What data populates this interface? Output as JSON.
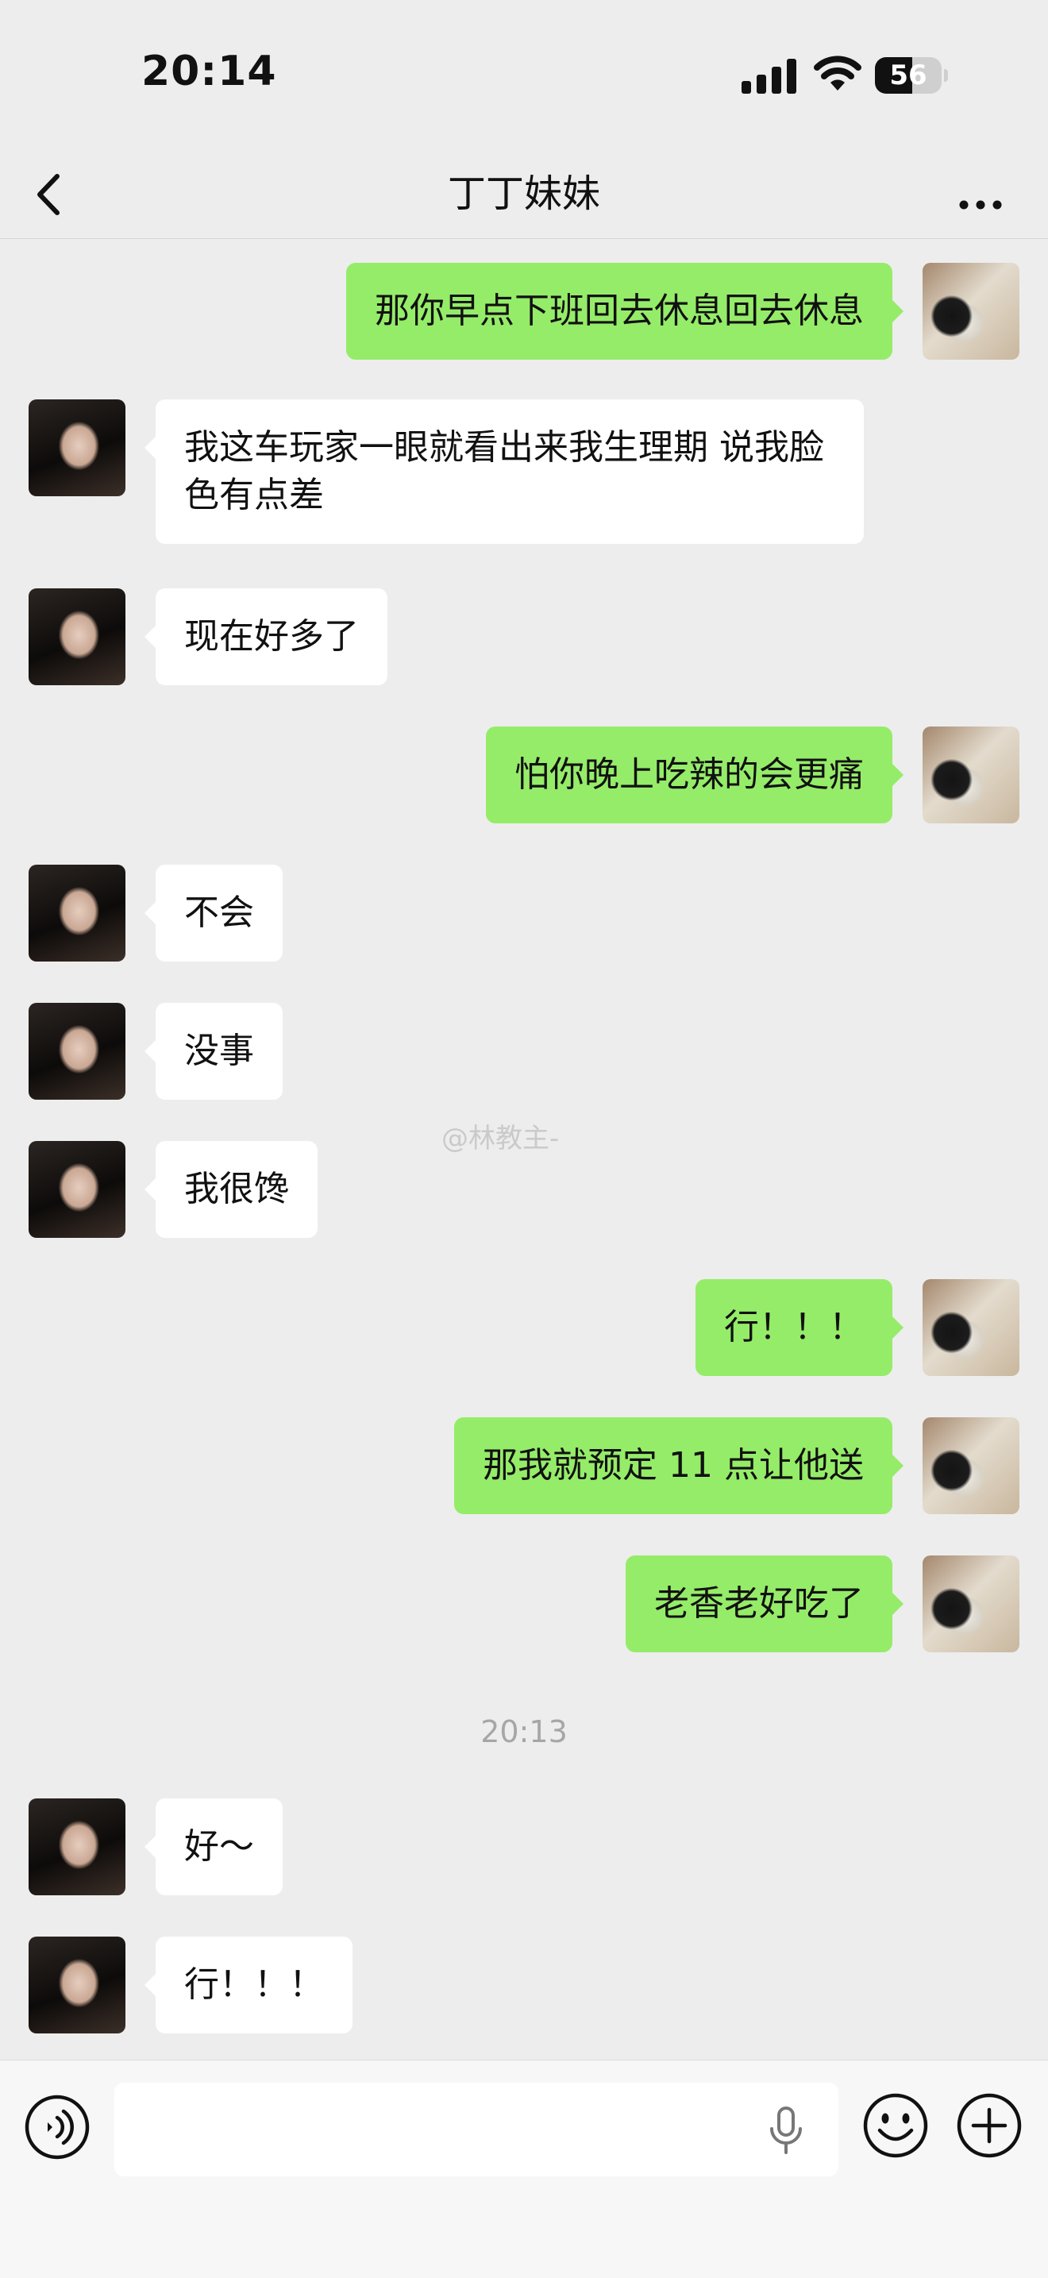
{
  "status_bar": {
    "time": "20:14",
    "battery_level": "56",
    "battery_fraction": 0.56
  },
  "header": {
    "title": "丁丁妹妹",
    "back_icon": "chevron-left-icon",
    "more_icon": "ellipsis-icon"
  },
  "messages": [
    {
      "direction": "out",
      "text": "那你早点下班回去休息回去休息"
    },
    {
      "direction": "in",
      "text": "我这车玩家一眼就看出来我生理期 说我脸色有点差"
    },
    {
      "direction": "in",
      "text": "现在好多了"
    },
    {
      "direction": "out",
      "text": "怕你晚上吃辣的会更痛"
    },
    {
      "direction": "in",
      "text": "不会"
    },
    {
      "direction": "in",
      "text": "没事"
    },
    {
      "direction": "in",
      "text": "我很馋"
    },
    {
      "direction": "out",
      "text": "行！！！"
    },
    {
      "direction": "out",
      "text": "那我就预定 11 点让他送"
    },
    {
      "direction": "out",
      "text": "老香老好吃了"
    },
    {
      "direction": "in",
      "text": "好～"
    },
    {
      "direction": "in",
      "text": "行！！！"
    }
  ],
  "timestamp": "20:13",
  "watermark": "@林教主-",
  "input_bar": {
    "placeholder": "",
    "voice_icon": "voice-wave-icon",
    "mic_icon": "microphone-icon",
    "emoji_icon": "smiley-icon",
    "plus_icon": "plus-circle-icon"
  }
}
